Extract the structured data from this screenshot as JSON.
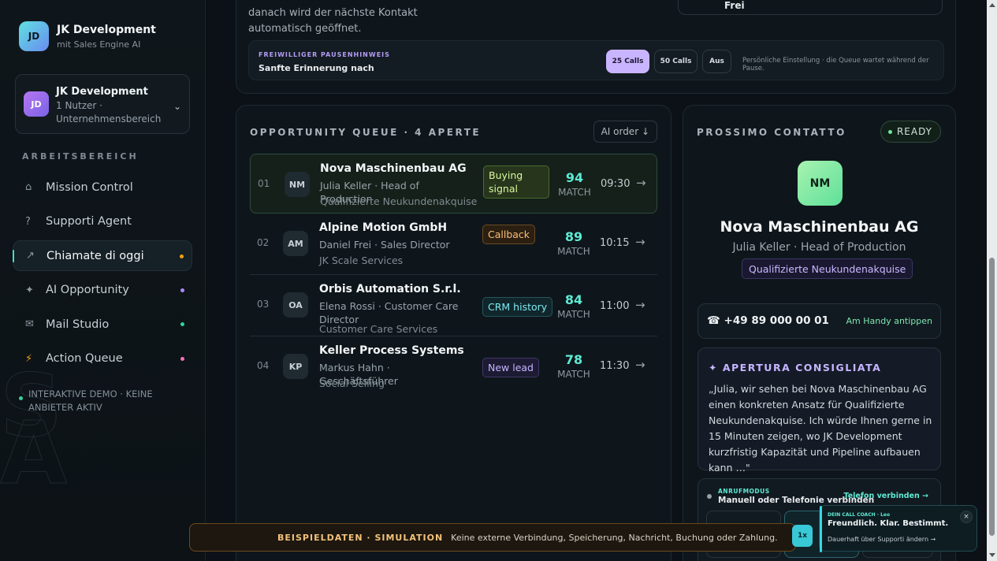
{
  "brand": {
    "logo": "JD",
    "name": "JK Development",
    "subtitle": "mit Sales Engine AI"
  },
  "account": {
    "logo": "JD",
    "name": "JK Development",
    "detail": "1 Nutzer · Unternehmensbereich",
    "chevron": "⌄"
  },
  "sidebar": {
    "section_title": "ARBEITSBEREICH",
    "items": [
      {
        "label": "Mission Control",
        "icon": "⌂",
        "icon_name": "home-icon",
        "dot": ""
      },
      {
        "label": "Supporti Agent",
        "icon": "?",
        "icon_name": "question-icon",
        "dot": ""
      },
      {
        "label": "Chiamate di oggi",
        "icon": "↗",
        "icon_name": "arrow-up-right-icon",
        "dot": "#f59e0b",
        "active": true
      },
      {
        "label": "AI Opportunity",
        "icon": "✦",
        "icon_name": "sparkle-icon",
        "dot": "#a78bfa"
      },
      {
        "label": "Mail Studio",
        "icon": "✉",
        "icon_name": "mail-icon",
        "dot": "#34d399"
      },
      {
        "label": "Action Queue",
        "icon": "⚡",
        "icon_name": "bolt-icon",
        "dot": "#f472b6"
      }
    ],
    "demo_note": "INTERAKTIVE DEMO · KEINE ANBIETER AKTIV"
  },
  "top_panel": {
    "text": "danach wird der nächste Kontakt automatisch geöffnet.",
    "right_box_value": "Frei",
    "pause": {
      "label": "FREIWILLIGER PAUSENHINWEIS",
      "value": "Sanfte Erinnerung nach",
      "options": [
        "25 Calls",
        "50 Calls",
        "Aus"
      ],
      "selected": "25 Calls",
      "note": "Persönliche Einstellung · die Queue wartet während der Pause."
    }
  },
  "queue": {
    "title": "OPPORTUNITY QUEUE · 4 APERTE",
    "sort_label": "AI order ↓",
    "match_label": "MATCH",
    "rows": [
      {
        "num": "01",
        "initials": "NM",
        "company": "Nova Maschinenbau AG",
        "person": "Julia Keller · Head of Production",
        "segment": "Qualifizierte Neukundenakquise",
        "tag": "Buying signal",
        "tag_color": "#d9f99d",
        "tag_bg": "#26351c",
        "tag_border": "#4b6b2f",
        "score": "94",
        "time": "09:30"
      },
      {
        "num": "02",
        "initials": "AM",
        "company": "Alpine Motion GmbH",
        "person": "Daniel Frei · Sales Director",
        "segment": "JK Scale Services",
        "tag": "Callback",
        "tag_color": "#fbbf77",
        "tag_bg": "#2b1f12",
        "tag_border": "#6b4a22",
        "score": "89",
        "time": "10:15"
      },
      {
        "num": "03",
        "initials": "OA",
        "company": "Orbis Automation S.r.l.",
        "person": "Elena Rossi · Customer Care Director",
        "segment": "Customer Care Services",
        "tag": "CRM history",
        "tag_color": "#7ee8f0",
        "tag_bg": "#10262b",
        "tag_border": "#25545c",
        "score": "84",
        "time": "11:00"
      },
      {
        "num": "04",
        "initials": "KP",
        "company": "Keller Process Systems",
        "person": "Markus Hahn · Geschäftsführer",
        "segment": "Social Selling",
        "tag": "New lead",
        "tag_color": "#c4b5fd",
        "tag_bg": "#1d1a33",
        "tag_border": "#3f3766",
        "score": "78",
        "time": "11:30"
      }
    ]
  },
  "contact": {
    "title": "PROSSIMO CONTATTO",
    "status": "READY",
    "initials": "NM",
    "company": "Nova Maschinenbau AG",
    "person": "Julia Keller · Head of Production",
    "segment": "Qualifizierte Neukundenakquise",
    "phone": "☎ +49 89 000 00 01",
    "tap_label": "Am Handy antippen",
    "opener_title": "✦ APERTURA CONSIGLIATA",
    "opener_text": "„Julia, wir sehen bei Nova Maschinenbau AG einen konkreten Ansatz für Qualifizierte Neukundenakquise. Ich würde Ihnen gerne in 15 Minuten zeigen, wo JK Development kurzfristig Kapazität und Pipeline aufbauen kann …\"",
    "mode_label": "ANRUFMODUS",
    "mode_value": "Manuell oder Telefonie verbinden",
    "mode_link": "Telefon verbinden →"
  },
  "simulation": {
    "label": "BEISPIELDATEN · SIMULATION",
    "text": "Keine externe Verbindung, Speicherung, Nachricht, Buchung oder Zahlung."
  },
  "coach": {
    "label": "DEIN CALL COACH · Leo",
    "title": "Freundlich. Klar. Bestimmt.",
    "sub": "Dauerhaft über Supporti ändern →",
    "close": "×",
    "speed": "1x"
  }
}
